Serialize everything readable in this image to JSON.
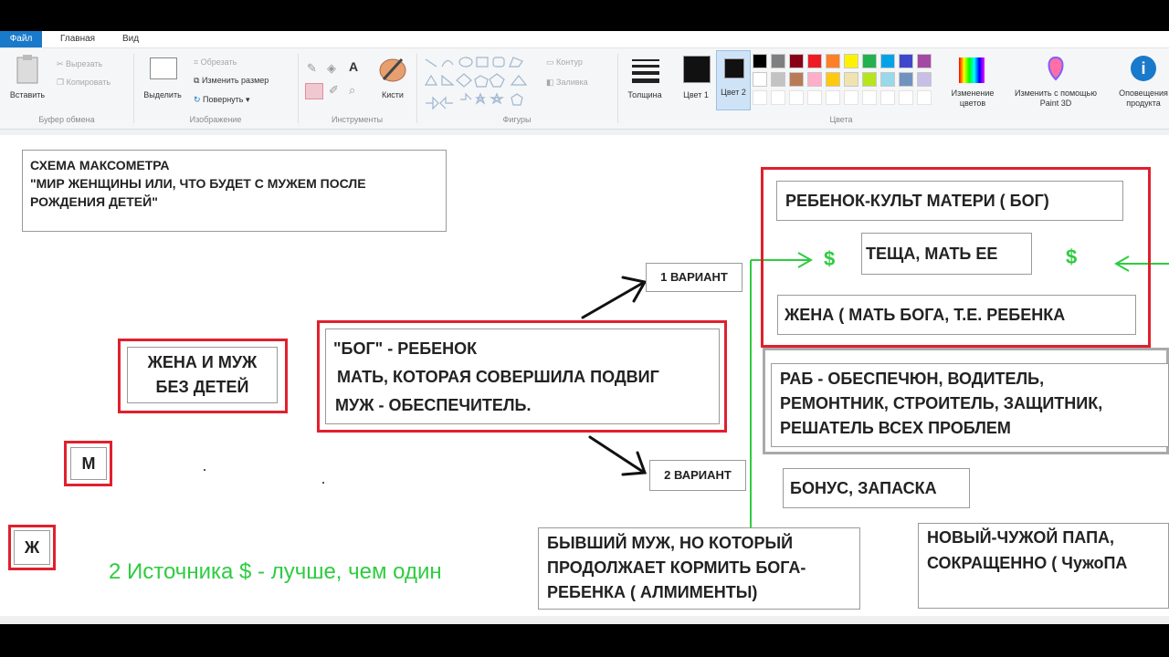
{
  "tabs": {
    "file": "Файл",
    "home": "Главная",
    "view": "Вид"
  },
  "ribbon": {
    "clipboard": {
      "paste": "Вставить",
      "cut": "Вырезать",
      "copy": "Копировать",
      "label": "Буфер обмена"
    },
    "image": {
      "select": "Выделить",
      "crop": "Обрезать",
      "resize": "Изменить размер",
      "rotate": "Повернуть",
      "label": "Изображение"
    },
    "tools": {
      "brushes": "Кисти",
      "label": "Инструменты"
    },
    "shapes": {
      "outline": "Контур",
      "fill": "Заливка",
      "label": "Фигуры"
    },
    "thickness": "Толщина",
    "color1": "Цвет 1",
    "color2": "Цвет 2",
    "colors_label": "Цвета",
    "edit_colors": "Изменение цветов",
    "paint3d": "Изменить с помощью Paint 3D",
    "notify": "Оповещения продукта",
    "palette_row1": [
      "#000000",
      "#7f7f7f",
      "#880015",
      "#ed1c24",
      "#ff7f27",
      "#fff200",
      "#22b14c",
      "#00a2e8",
      "#3f48cc",
      "#a349a4"
    ],
    "palette_row2": [
      "#ffffff",
      "#c3c3c3",
      "#b97a57",
      "#ffaec9",
      "#ffc90e",
      "#efe4b0",
      "#b5e61d",
      "#99d9ea",
      "#7092be",
      "#c8bfe7"
    ]
  },
  "canvas": {
    "title_lines": [
      "СХЕМА МАКСОМЕТРА",
      "\"МИР ЖЕНЩИНЫ ИЛИ, ЧТО БУДЕТ С МУЖЕМ ПОСЛЕ",
      "РОЖДЕНИЯ ДЕТЕЙ\""
    ],
    "couple_lines": [
      "ЖЕНА И МУЖ",
      "БЕЗ ДЕТЕЙ"
    ],
    "m_label": "М",
    "zh_label": "Ж",
    "center_lines": [
      "\"БОГ\" - РЕБЕНОК",
      "МАТЬ, КОТОРАЯ СОВЕРШИЛА ПОДВИГ",
      "МУЖ - ОБЕСПЕЧИТЕЛЬ."
    ],
    "variant1": "1 ВАРИАНТ",
    "variant2": "2 ВАРИАНТ",
    "child_cult": "РЕБЕНОК-КУЛЬТ МАТЕРИ ( БОГ)",
    "mother_in_law": "ТЕЩА, МАТЬ ЕЕ",
    "wife_line": "ЖЕНА ( МАТЬ БОГА, Т.Е. РЕБЕНКА",
    "dollar": "$",
    "slave_lines": [
      "РАБ - ОБЕСПЕЧЮН, ВОДИТЕЛЬ,",
      "РЕМОНТНИК, СТРОИТЕЛЬ, ЗАЩИТНИК,",
      "РЕШАТЕЛЬ ВСЕХ  ПРОБЛЕМ"
    ],
    "bonus": "БОНУС, ЗАПАСКА",
    "ex_lines": [
      "БЫВШИЙ МУЖ, НО КОТОРЫЙ",
      "ПРОДОЛЖАЕТ КОРМИТЬ БОГА-",
      "РЕБЕНКА ( АЛМИМЕНТЫ)"
    ],
    "new_dad_lines": [
      "НОВЫЙ-ЧУЖОЙ ПАПА,",
      "СОКРАЩЕННО ( ЧужоПА"
    ],
    "sources": "2 Источника $  - лучше, чем один"
  },
  "colors": {
    "red": "#e0202e",
    "green": "#2ecc40",
    "accent": "#1979ca"
  }
}
